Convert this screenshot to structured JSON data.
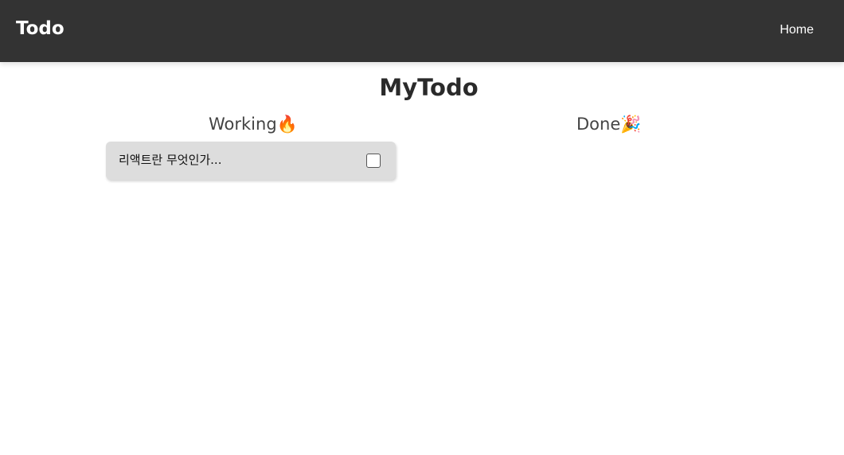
{
  "navbar": {
    "brand": "Todo",
    "links": [
      "Home"
    ]
  },
  "main": {
    "title": "MyTodo",
    "columns": [
      {
        "heading": "Working🔥",
        "items": [
          {
            "text": "리액트란 무엇인가...",
            "checked": false
          }
        ]
      },
      {
        "heading": "Done🎉",
        "items": []
      }
    ]
  },
  "colors": {
    "navbar_bg": "#333333",
    "card_bg": "#dddddd",
    "text_dark": "#2a2a2a"
  }
}
